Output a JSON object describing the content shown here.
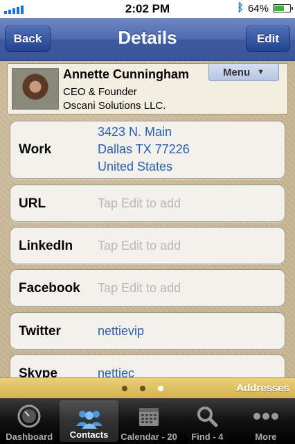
{
  "status_bar": {
    "time": "2:02 PM",
    "battery": "64%",
    "battery_level": 0.64
  },
  "nav": {
    "title": "Details",
    "back_label": "Back",
    "edit_label": "Edit"
  },
  "contact": {
    "name": "Annette Cunningham",
    "title": "CEO & Founder",
    "company": "Oscani Solutions LLC.",
    "menu_label": "Menu",
    "menu_arrow": "▼"
  },
  "rows": {
    "work": {
      "label": "Work",
      "address_line1": "3423 N. Main",
      "address_line2": "Dallas TX 77226",
      "address_line3": "United States"
    },
    "url": {
      "label": "URL",
      "value": "Tap Edit to add"
    },
    "linkedin": {
      "label": "LinkedIn",
      "value": "Tap Edit to add"
    },
    "facebook": {
      "label": "Facebook",
      "value": "Tap Edit to add"
    },
    "twitter": {
      "label": "Twitter",
      "value": "nettievip"
    },
    "skype": {
      "label": "Skype",
      "value": "nettiec"
    }
  },
  "page_bar": {
    "label": "Addresses",
    "current_page": 3,
    "total_pages": 3
  },
  "tabs": [
    {
      "label": "Dashboard",
      "icon": "speedometer-icon"
    },
    {
      "label": "Contacts",
      "icon": "people-icon",
      "active": true
    },
    {
      "label": "Calendar - 20",
      "icon": "calendar-icon"
    },
    {
      "label": "Find - 4",
      "icon": "search-icon"
    },
    {
      "label": "More",
      "icon": "more-dots-icon"
    }
  ],
  "colors": {
    "nav_blue": "#4e6bb0",
    "link_blue": "#2a5db0",
    "page_bar_gold": "#d9bb5e"
  }
}
